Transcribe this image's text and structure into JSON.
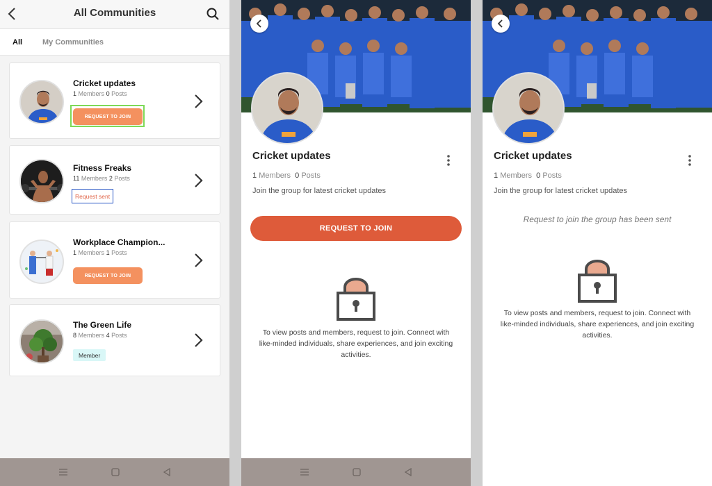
{
  "list_screen": {
    "title": "All Communities",
    "tabs": [
      {
        "label": "All"
      },
      {
        "label": "My Communities"
      }
    ],
    "communities": [
      {
        "name": "Cricket updates",
        "members": "1",
        "members_label": "Members",
        "posts": "0",
        "posts_label": "Posts",
        "action": "REQUEST TO JOIN"
      },
      {
        "name": "Fitness Freaks",
        "members": "11",
        "members_label": "Members",
        "posts": "2",
        "posts_label": "Posts",
        "status": "Request sent"
      },
      {
        "name": "Workplace Champion...",
        "members": "1",
        "members_label": "Members",
        "posts": "1",
        "posts_label": "Posts",
        "action": "REQUEST TO JOIN"
      },
      {
        "name": "The Green Life",
        "members": "8",
        "members_label": "Members",
        "posts": "4",
        "posts_label": "Posts",
        "badge": "Member"
      }
    ]
  },
  "detail_screen": {
    "group_name": "Cricket updates",
    "members": "1",
    "members_label": "Members",
    "posts": "0",
    "posts_label": "Posts",
    "description": "Join the group for latest cricket updates",
    "join_button": "REQUEST TO JOIN",
    "locked_info": "To view posts and members, request to join. Connect with like-minded individuals, share experiences, and join exciting activities."
  },
  "sent_screen": {
    "group_name": "Cricket updates",
    "members": "1",
    "members_label": "Members",
    "posts": "0",
    "posts_label": "Posts",
    "description": "Join the group for latest cricket updates",
    "sent_message": "Request to join the group has been sent",
    "locked_info": "To view posts and members, request to join. Connect with like-minded individuals, share experiences, and join exciting activities."
  },
  "colors": {
    "join_small": "#f4915f",
    "join_large": "#de5b3a",
    "jersey_blue": "#2a5cc8",
    "member_badge": "#d9f7f7",
    "nav_bar": "#a09692"
  },
  "icons": [
    "back-arrow-icon",
    "search-icon",
    "chevron-right-icon",
    "kebab-menu-icon",
    "lock-icon",
    "nav-menu-icon",
    "nav-home-icon",
    "nav-back-icon"
  ]
}
